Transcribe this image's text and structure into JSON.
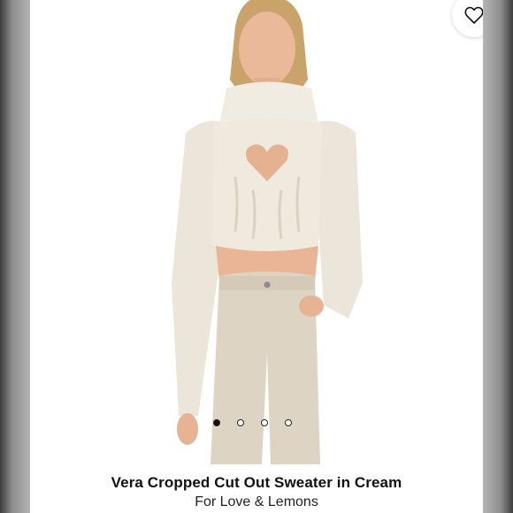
{
  "product": {
    "title": "Vera Cropped Cut Out Sweater in Cream",
    "brand": "For Love & Lemons"
  },
  "gallery": {
    "image_count": 4,
    "active_index": 0
  },
  "icons": {
    "wishlist": "heart-outline-icon"
  },
  "colors": {
    "sweater": "#eee9dd",
    "jeans": "#ddd4c4",
    "frame": "#7a7a7a"
  }
}
